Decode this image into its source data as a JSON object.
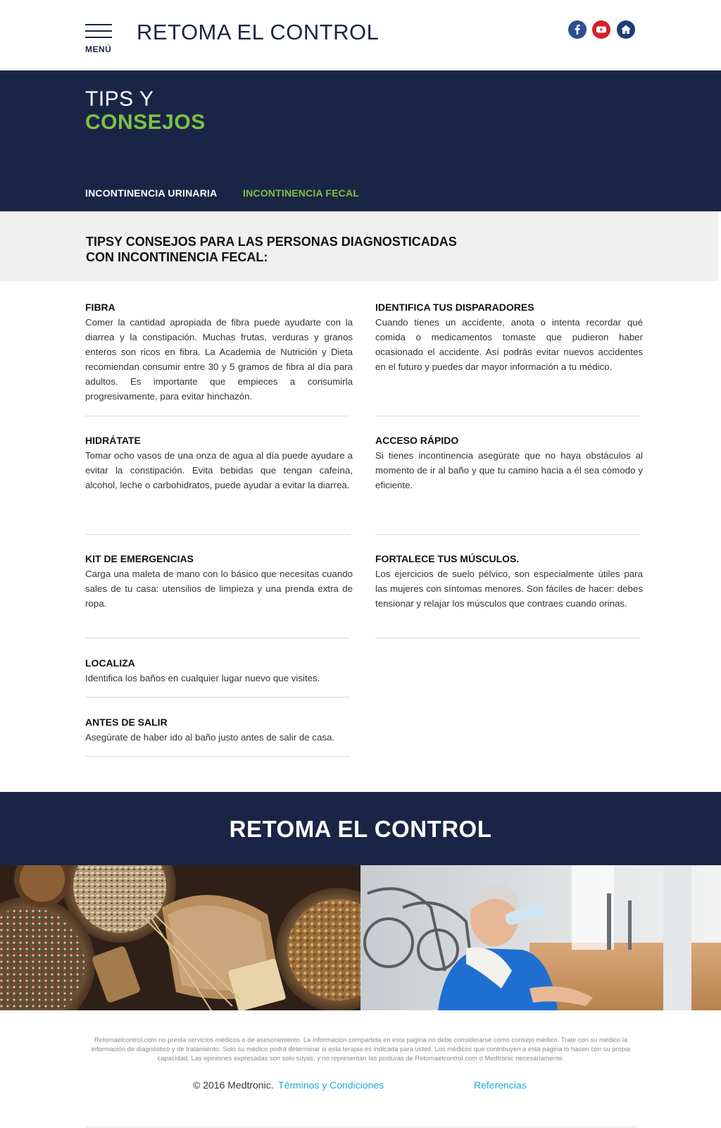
{
  "header": {
    "menu_label": "MENÚ",
    "brand": "RETOMA EL CONTROL",
    "social": [
      "facebook-icon",
      "youtube-icon",
      "home-icon"
    ]
  },
  "hero": {
    "line1": "TIPS Y",
    "line2": "CONSEJOS",
    "tabs": [
      {
        "label": "INCONTINENCIA URINARIA",
        "active": false
      },
      {
        "label": "INCONTINENCIA FECAL",
        "active": true
      }
    ]
  },
  "section": {
    "title": "TIPSY CONSEJOS PARA LAS PERSONAS DIAGNOSTICADAS CON INCONTINENCIA FECAL:"
  },
  "tips": [
    {
      "title": "FIBRA",
      "body": "Comer la cantidad apropiada de fibra puede ayudarte con la diarrea y la constipación. Muchas frutas, verduras y granos enteros son ricos en fibra. La Academia de Nutrición y Dieta recomiendan consumir entre 30 y 5 gramos de fibra al día para adultos. Es importante que empieces a consumirla progresivamente, para evitar hinchazón."
    },
    {
      "title": "IDENTIFICA TUS DISPARADORES",
      "body": "Cuando tienes un accidente, anota o intenta recordar qué comida o medicamentos tomaste que pudieron haber ocasionado el accidente. Así podrás evitar nuevos accidentes en el futuro y puedes dar mayor información a tu médico."
    },
    {
      "title": "HIDRÁTATE",
      "body": "Tomar ocho vasos de una onza de agua al día puede ayudare a evitar la constipación. Evita bebidas que tengan cafeína, alcohol, leche o carbohidratos, puede ayudar a evitar la diarrea."
    },
    {
      "title": "ACCESO RÁPIDO",
      "body": "Si tienes incontinencia asegúrate que no haya obstáculos al momento de ir al baño y que tu camino hacia a él sea cómodo y eficiente."
    },
    {
      "title": "KIT DE EMERGENCIAS",
      "body": "Carga una maleta de mano con lo básico que necesitas cuando sales de tu casa: utensilios de limpieza y una prenda extra de ropa."
    },
    {
      "title": "FORTALECE TUS MÚSCULOS.",
      "body": "Los ejercicios de suelo pélvico, son especialmente útiles para las mujeres con síntomas menores. Son fáciles de hacer: debes tensionar y relajar los músculos que contraes cuando orinas."
    },
    {
      "title": "LOCALIZA",
      "body": "Identifica los baños en cualquier lugar nuevo que visites."
    },
    {
      "title": "ANTES DE SALIR",
      "body": "Asegúrate de haber ido al baño justo antes de salir de casa."
    }
  ],
  "banner": {
    "title": "RETOMA EL CONTROL"
  },
  "footer": {
    "disclaimer": "Retomaelcontrol.com no presta servicios médicos o de asesoramiento. La información compartida en esta pagina no debe considerarse como consejo médico. Trate con su médico la información de diagnóstico y de tratamiento. Solo su médico podrá determinar si esta terapia es indicada para usted. Los médicos que contribuyen a esta página lo hacen con su propia capacidad. Las opiniones expresadas son solo suyas, y no representan las posturas de Retomaelcontrol.com o Medtronic necesariamente.",
    "copyright": "© 2016 Medtronic.",
    "terms": "Términos y Condiciones",
    "references": "Referencias"
  },
  "colors": {
    "navy": "#1a2546",
    "green": "#7dc242",
    "link": "#1fa7d9"
  }
}
